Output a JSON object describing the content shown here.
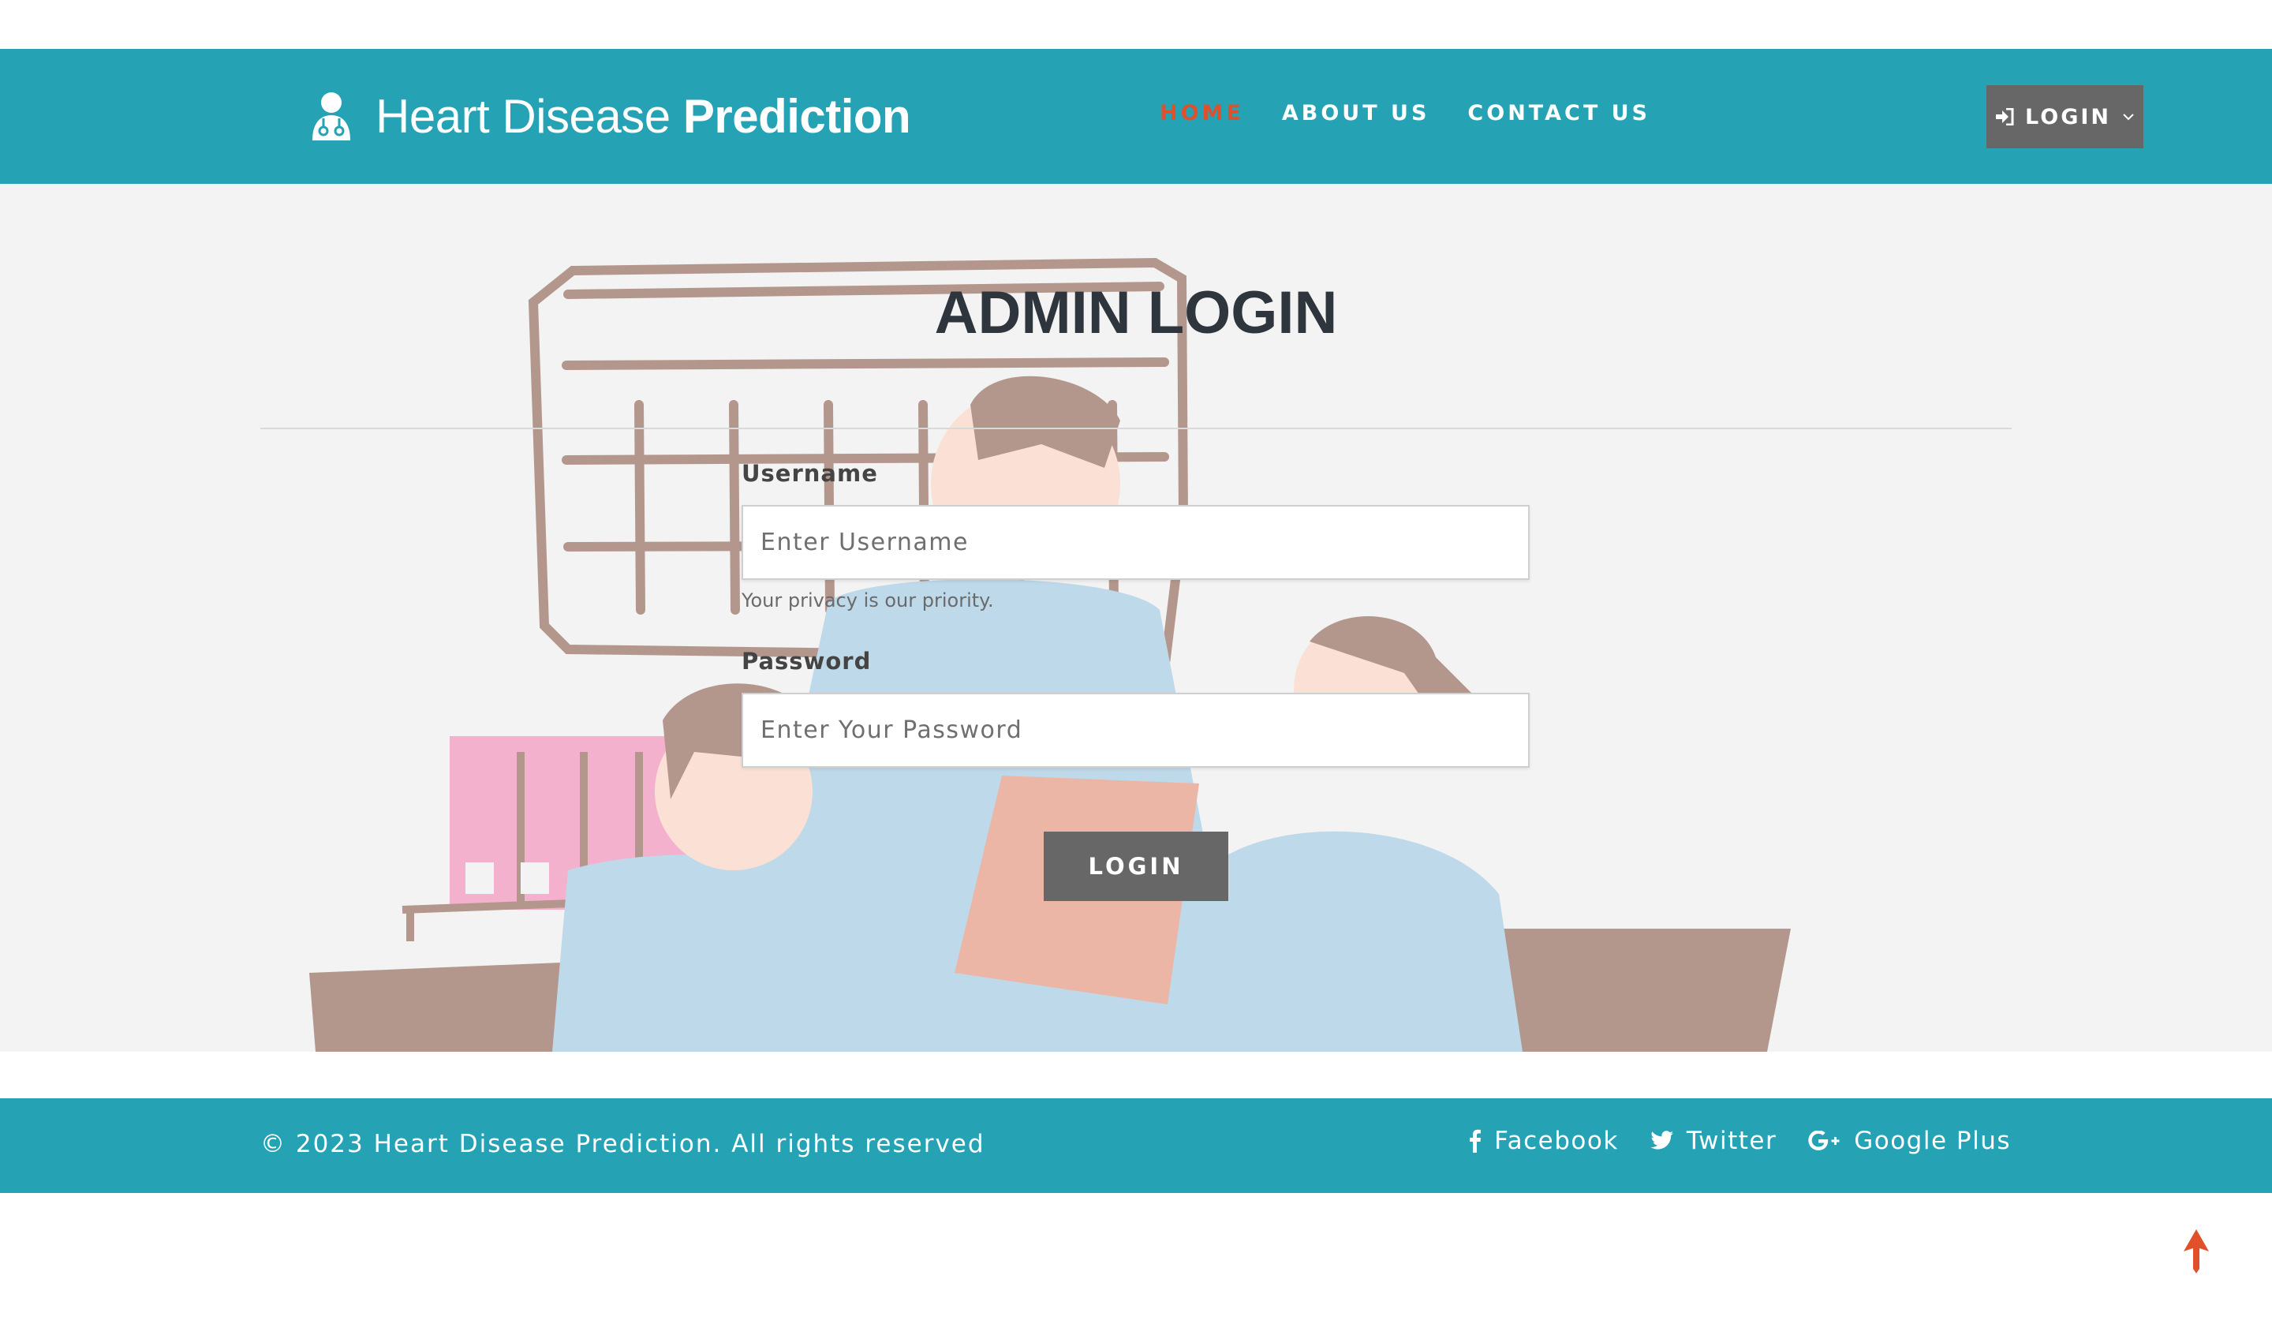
{
  "header": {
    "brand": {
      "light": "Heart Disease ",
      "bold": "Prediction",
      "icon": "doctor-icon"
    },
    "nav": [
      {
        "label": "HOME",
        "active": true
      },
      {
        "label": "ABOUT US",
        "active": false
      },
      {
        "label": "CONTACT US",
        "active": false
      }
    ],
    "login_button": {
      "label": "LOGIN",
      "icon": "sign-in-icon"
    }
  },
  "main": {
    "title": "ADMIN LOGIN",
    "username": {
      "label": "Username",
      "placeholder": "Enter Username",
      "value": "",
      "help": "Your privacy is our priority."
    },
    "password": {
      "label": "Password",
      "placeholder": "Enter Your Password",
      "value": ""
    },
    "submit_label": "LOGIN"
  },
  "footer": {
    "copyright": "© 2023 Heart Disease Prediction. All rights reserved",
    "social": [
      {
        "label": "Facebook",
        "icon": "facebook-icon"
      },
      {
        "label": "Twitter",
        "icon": "twitter-icon"
      },
      {
        "label": "Google Plus",
        "icon": "google-plus-icon"
      }
    ]
  },
  "colors": {
    "primary": "#25a3b5",
    "accent": "#e0502a",
    "button": "#676767",
    "title": "#2f353c",
    "background": "#f3f3f3"
  }
}
